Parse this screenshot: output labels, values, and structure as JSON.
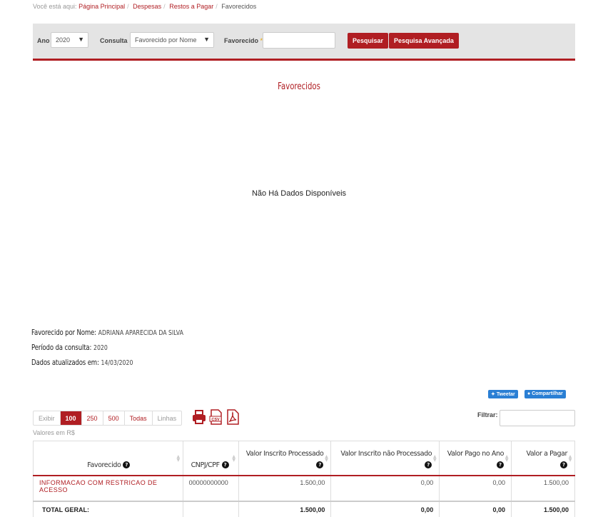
{
  "breadcrumb": {
    "prefix": "Você está aqui:",
    "items": [
      "Página Principal",
      "Despesas",
      "Restos a Pagar"
    ],
    "current": "Favorecidos"
  },
  "filters": {
    "ano_label": "Ano",
    "ano_value": "2020",
    "consulta_label": "Consulta",
    "consulta_value": "Favorecido por Nome",
    "favorecido_label": "Favorecido",
    "favorecido_required": "*",
    "favorecido_value": "",
    "search_button": "Pesquisar",
    "advanced_button": "Pesquisa Avançada"
  },
  "chart": {
    "title": "Favorecidos",
    "empty_message": "Não Há Dados Disponíveis"
  },
  "info": {
    "favorecido_label": "Favorecido por Nome:",
    "favorecido_value": "ADRIANA APARECIDA DA SILVA",
    "periodo_label": "Período da consulta:",
    "periodo_value": "2020",
    "atualizado_label": "Dados atualizados em:",
    "atualizado_value": "14/03/2020"
  },
  "share": {
    "tweet": "Tweetar",
    "facebook": "Compartilhar"
  },
  "pager": {
    "exibir": "Exibir",
    "options": [
      "100",
      "250",
      "500",
      "Todas"
    ],
    "selected": "100",
    "linhas": "Linhas"
  },
  "icons": [
    "printer-icon",
    "csv-icon",
    "pdf-icon"
  ],
  "valores_note": "Valores em R$",
  "filtrar_label": "Filtrar:",
  "table": {
    "headers": [
      "Favorecido",
      "CNPJ/CPF",
      "Valor Inscrito Processado",
      "Valor Inscrito não Processado",
      "Valor Pago no Ano",
      "Valor a Pagar"
    ],
    "rows": [
      {
        "favorecido": "INFORMACAO COM RESTRICAO DE ACESSO",
        "cnpj": "00000000000",
        "processado": "1.500,00",
        "nao_processado": "0,00",
        "pago": "0,00",
        "a_pagar": "1.500,00"
      }
    ],
    "total": {
      "label": "TOTAL GERAL:",
      "processado": "1.500,00",
      "nao_processado": "0,00",
      "pago": "0,00",
      "a_pagar": "1.500,00"
    }
  },
  "colors": {
    "accent": "#b01e23",
    "filter_bg": "#e4e4e4",
    "share_blue": "#2a7fd4"
  }
}
